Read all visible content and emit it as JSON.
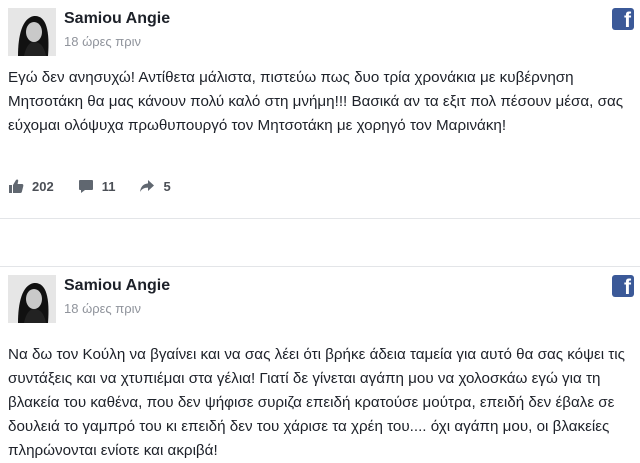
{
  "posts": [
    {
      "author": "Samiou Angie",
      "time": "18 ώρες πριν",
      "text": "Εγώ δεν ανησυχώ! Αντίθετα μάλιστα, πιστεύω πως δυο τρία χρονάκια με κυβέρνηση Μητσοτάκη θα μας κάνουν πολύ καλό στη μνήμη!!! Βασικά αν τα εξιτ πολ πέσουν μέσα, σας εύχομαι ολόψυχα πρωθυπουργό τον Μητσοτάκη με χορηγό τον Μαρινάκη!",
      "likes": "202",
      "comments": "11",
      "shares": "5"
    },
    {
      "author": "Samiou Angie",
      "time": "18 ώρες πριν",
      "text": "Να δω τον Κούλη να βγαίνει και να σας λέει ότι βρήκε άδεια ταμεία για αυτό θα σας κόψει τις συντάξεις και να χτυπιέμαι στα γέλια! Γιατί δε γίνεται αγάπη μου να χολοσκάω εγώ για τη βλακεία του καθένα, που δεν ψήφισε συριζα επειδή κρατούσε μούτρα, επειδή δεν έβαλε σε δουλειά το γαμπρό του κι επειδή δεν του χάρισε τα χρέη του.... όχι αγάπη μου, οι βλακείες πληρώνονται ενίοτε και ακριβά!"
    }
  ],
  "icons": {
    "like": "thumbs-up-icon",
    "comment": "comment-icon",
    "share": "share-icon",
    "brand": "facebook-icon"
  },
  "colors": {
    "facebook_blue": "#3b5998",
    "meta_gray": "#90949c",
    "stat_gray": "#606770"
  }
}
